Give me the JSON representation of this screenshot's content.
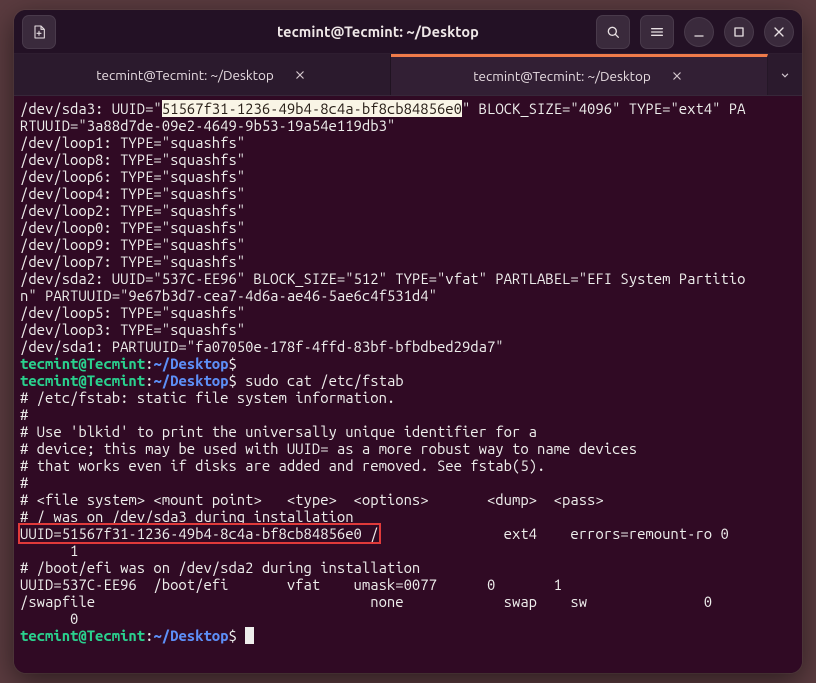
{
  "title": "tecmint@Tecmint: ~/Desktop",
  "newTabTooltip": "New Tab",
  "tabs": [
    {
      "label": "tecmint@Tecmint: ~/Desktop",
      "active": false
    },
    {
      "label": "tecmint@Tecmint: ~/Desktop",
      "active": true
    }
  ],
  "prompt": {
    "user": "tecmint",
    "host": "Tecmint",
    "path": "~/Desktop"
  },
  "out1": {
    "sda3_a": "/dev/sda3: UUID=\"",
    "sda3_uuid": "51567f31-1236-49b4-8c4a-bf8cb84856e0",
    "sda3_b": "\" BLOCK_SIZE=\"4096\" TYPE=\"ext4\" PA",
    "sda3_c": "RTUUID=\"3a88d7de-09e2-4649-9b53-19a54e119db3\"",
    "loop1": "/dev/loop1: TYPE=\"squashfs\"",
    "loop8": "/dev/loop8: TYPE=\"squashfs\"",
    "loop6": "/dev/loop6: TYPE=\"squashfs\"",
    "loop4": "/dev/loop4: TYPE=\"squashfs\"",
    "loop2": "/dev/loop2: TYPE=\"squashfs\"",
    "loop0": "/dev/loop0: TYPE=\"squashfs\"",
    "loop9": "/dev/loop9: TYPE=\"squashfs\"",
    "loop7": "/dev/loop7: TYPE=\"squashfs\"",
    "sda2_a": "/dev/sda2: UUID=\"537C-EE96\" BLOCK_SIZE=\"512\" TYPE=\"vfat\" PARTLABEL=\"EFI System Partitio",
    "sda2_b": "n\" PARTUUID=\"9e67b3d7-cea7-4d6a-ae46-5ae6c4f531d4\"",
    "loop5": "/dev/loop5: TYPE=\"squashfs\"",
    "loop3": "/dev/loop3: TYPE=\"squashfs\"",
    "sda1": "/dev/sda1: PARTUUID=\"fa07050e-178f-4ffd-83bf-bfbdbed29da7\""
  },
  "cmd2": " sudo cat /etc/fstab",
  "out2": {
    "l1": "# /etc/fstab: static file system information.",
    "l2": "#",
    "l3": "# Use 'blkid' to print the universally unique identifier for a",
    "l4": "# device; this may be used with UUID= as a more robust way to name devices",
    "l5": "# that works even if disks are added and removed. See fstab(5).",
    "l6": "#",
    "l7": "# <file system> <mount point>   <type>  <options>       <dump>  <pass>",
    "l8": "# / was on /dev/sda3 during installation",
    "l9a": "UUID=51567f31-1236-49b4-8c4a-bf8cb84856e0 /",
    "l9b": "               ext4    errors=remount-ro 0 ",
    "l10": "      1",
    "l11": "# /boot/efi was on /dev/sda2 during installation",
    "l12": "UUID=537C-EE96  /boot/efi       vfat    umask=0077      0       1",
    "l13": "/swapfile                                 none            swap    sw              0 ",
    "l14": "      0"
  }
}
